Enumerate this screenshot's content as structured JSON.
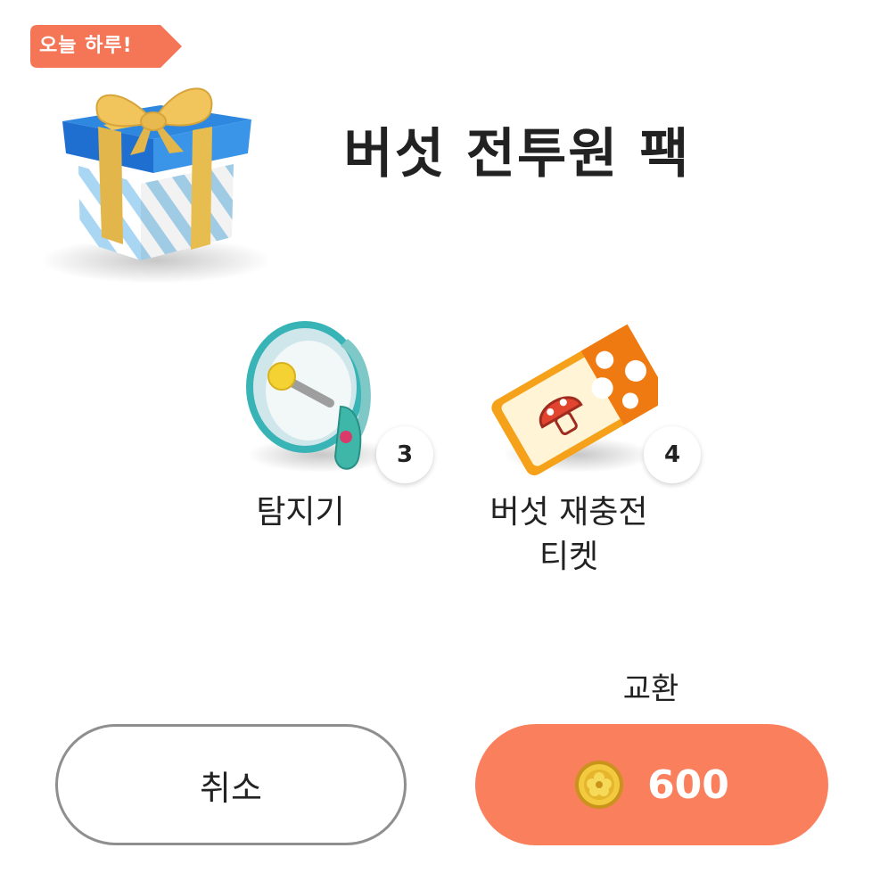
{
  "badge": {
    "label": "오늘 하루!"
  },
  "pack": {
    "title": "버섯 전투원 팩"
  },
  "rewards": [
    {
      "name": "탐지기",
      "count": "3",
      "icon": "megaphone-detector-icon"
    },
    {
      "name_line1": "버섯 재충전",
      "name_line2": "티켓",
      "count": "4",
      "icon": "mushroom-ticket-icon"
    }
  ],
  "actions": {
    "exchange_label": "교환",
    "cancel_label": "취소",
    "price": "600",
    "currency_icon": "gold-coin-icon"
  },
  "colors": {
    "accent": "#fa7f5d",
    "badge": "#f47657"
  }
}
